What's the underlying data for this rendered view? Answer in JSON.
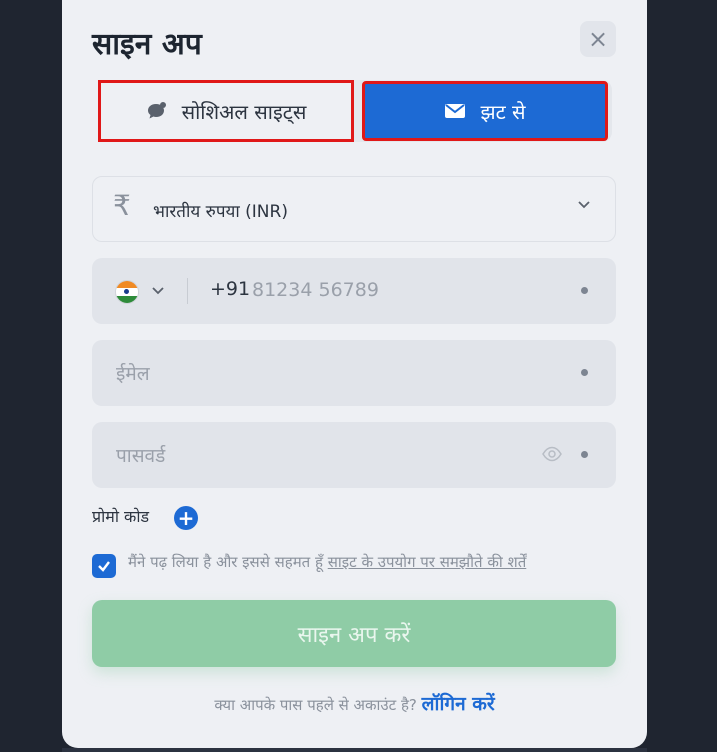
{
  "modal": {
    "title": "साइन अप",
    "close_label": "×"
  },
  "tabs": {
    "social": {
      "label": "सोशिअल साइट्स",
      "icon": "chat-bubble-icon"
    },
    "quick": {
      "label": "झट से",
      "icon": "envelope-icon"
    }
  },
  "currency": {
    "symbol": "₹",
    "label": "भारतीय रुपया (INR)"
  },
  "phone": {
    "country_flag": "india-flag",
    "code": "+91",
    "placeholder": "81234 56789"
  },
  "email": {
    "placeholder": "ईमेल"
  },
  "password": {
    "placeholder": "पासवर्ड"
  },
  "promo": {
    "label": "प्रोमो कोड",
    "add_label": "+"
  },
  "terms": {
    "checked": true,
    "prefix": "मैंने पढ़ लिया है और इससे सहमत हूँ ",
    "link": "साइट के उपयोग पर समझौते की शर्तें"
  },
  "signup_button": {
    "label": "साइन अप करें"
  },
  "login": {
    "prompt": "क्या आपके पास पहले से अकाउंट है? ",
    "link": "लॉगिन करें"
  },
  "colors": {
    "accent": "#1d6ad4",
    "signup_button": "#8fcca6",
    "highlight_border": "#e01818"
  }
}
